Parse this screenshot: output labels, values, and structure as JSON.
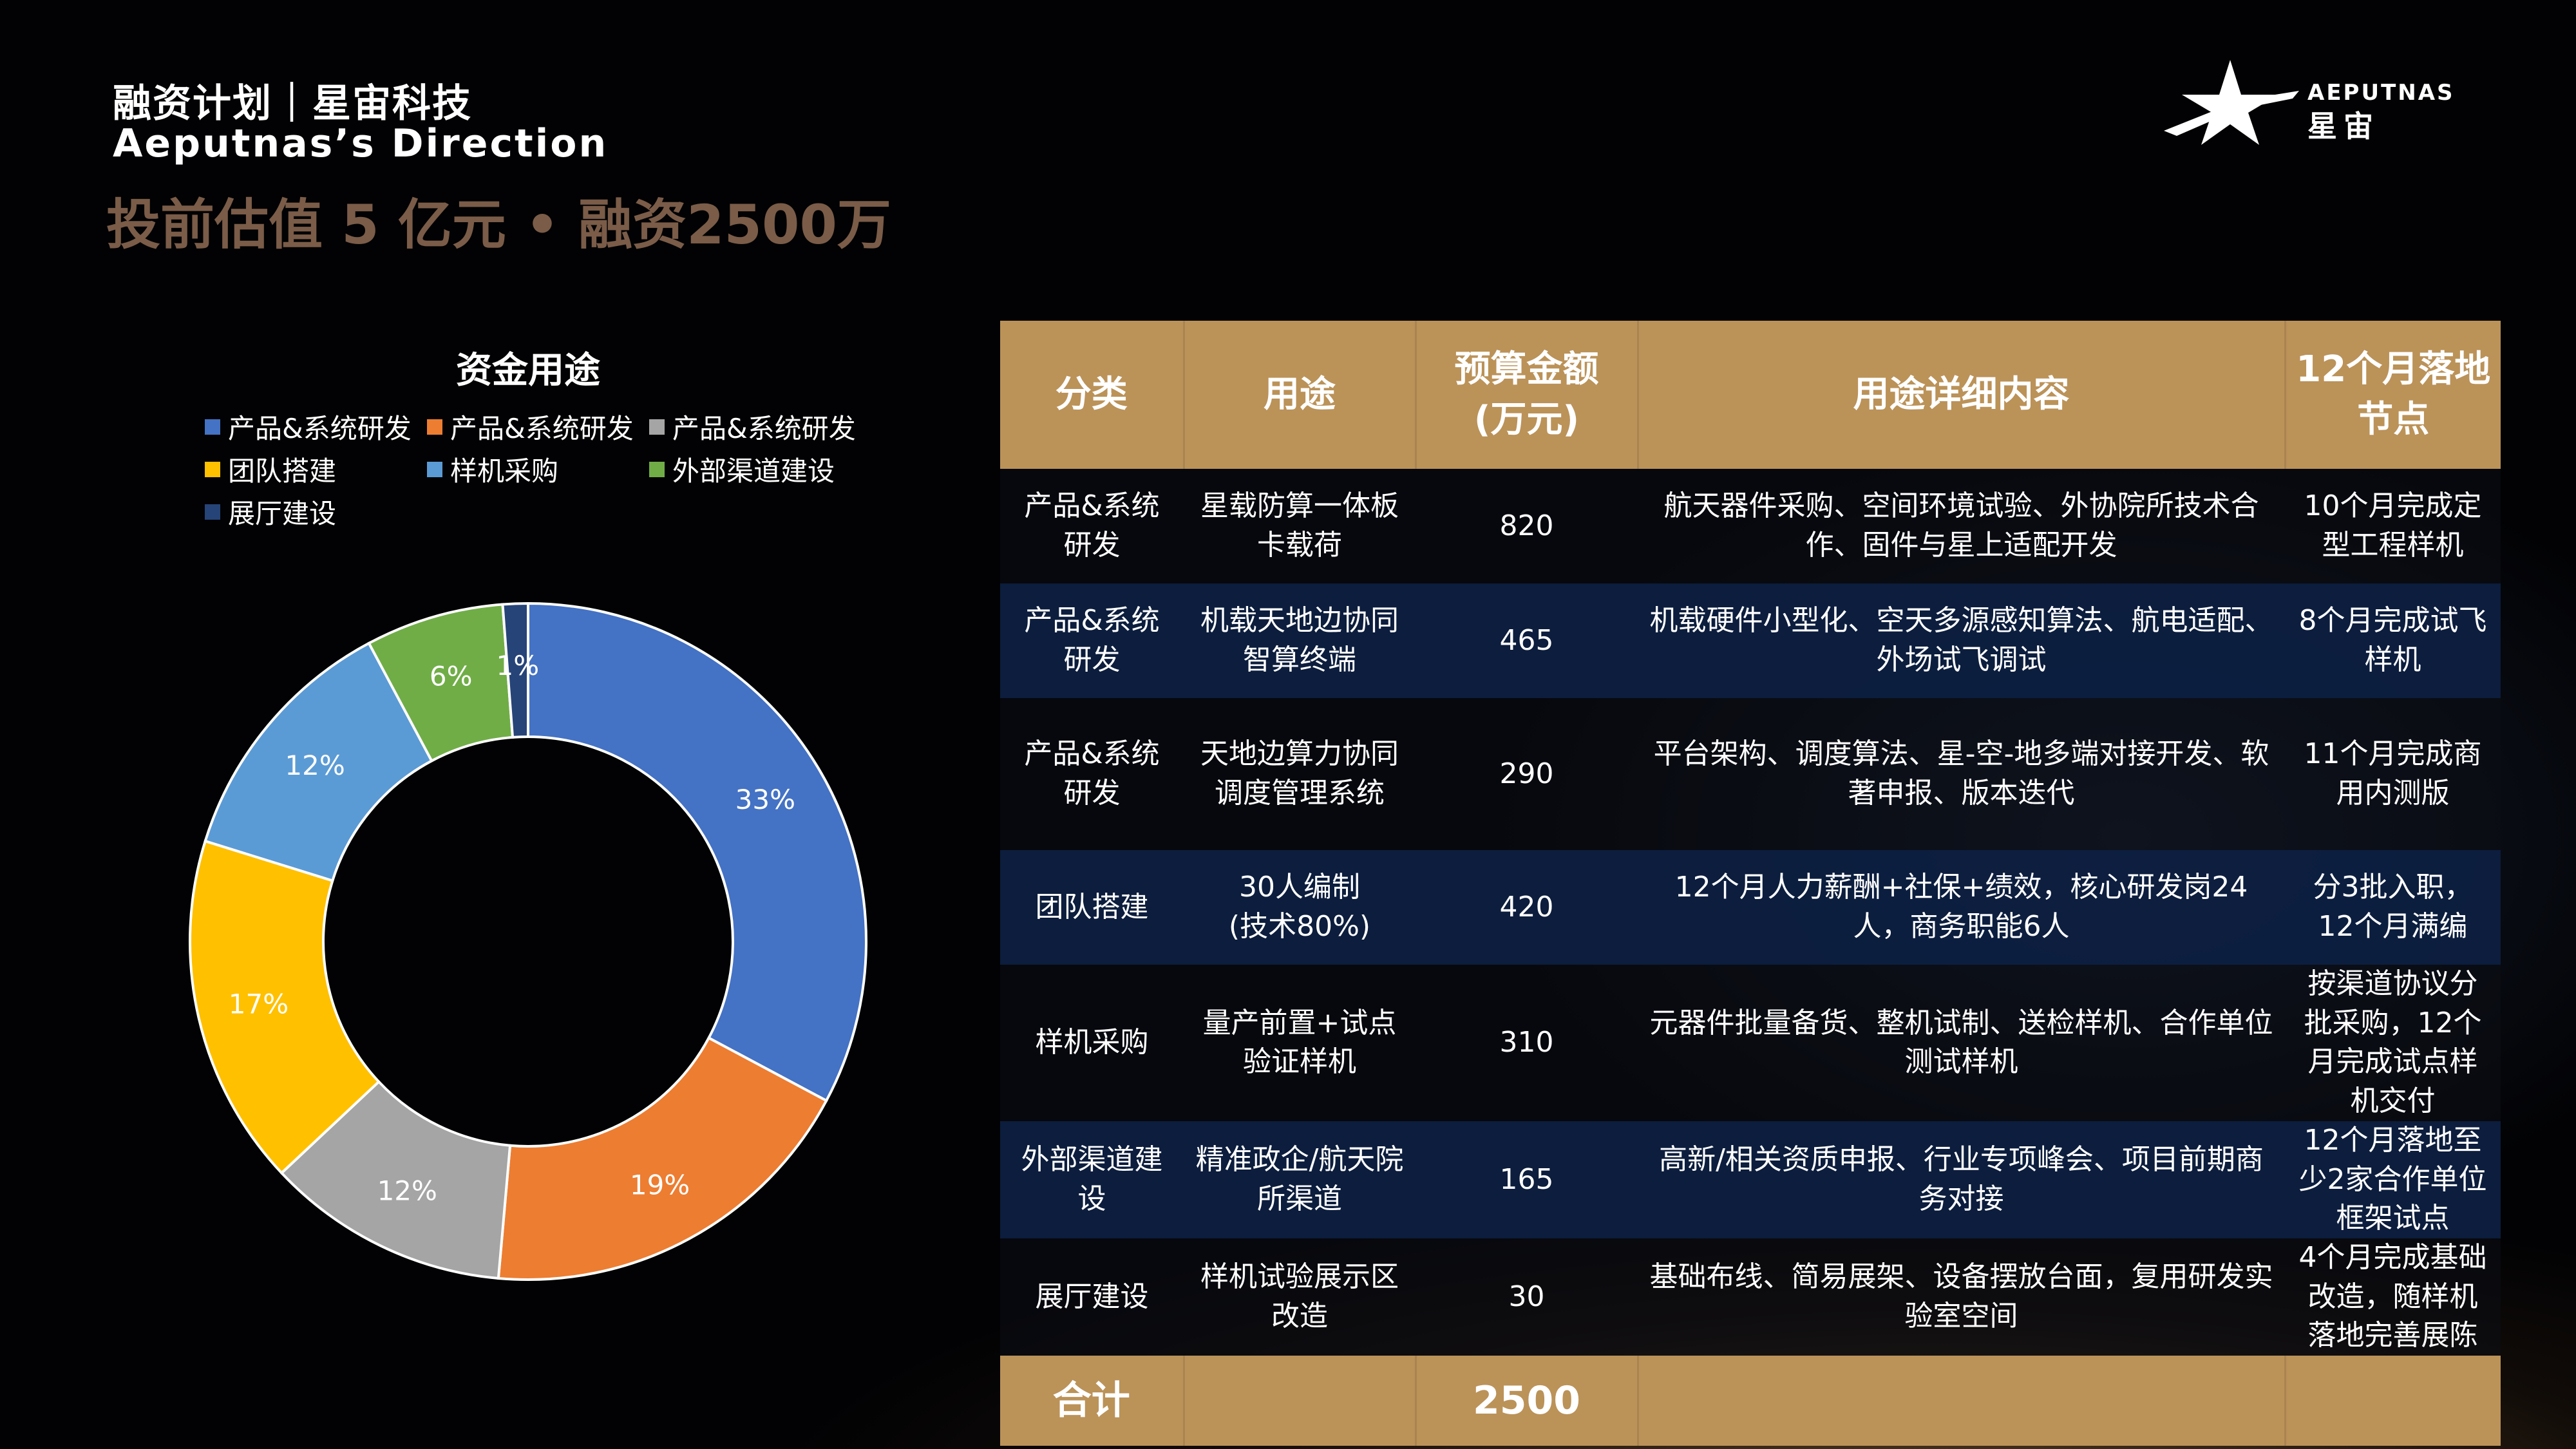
{
  "header": {
    "title_line1": "融资计划｜星宙科技",
    "title_line2": "Aeputnas’s Direction",
    "headline": "投前估值 5 亿元 • 融资2500万"
  },
  "logo": {
    "brand_en": "AEPUTNAS",
    "brand_cn": "星宙",
    "icon": "star-icon"
  },
  "chart_data": {
    "type": "pie",
    "variant": "donut",
    "title": "资金用途",
    "legend_position": "top",
    "categories": [
      "产品&系统研发",
      "产品&系统研发",
      "产品&系统研发",
      "团队搭建",
      "样机采购",
      "外部渠道建设",
      "展厅建设"
    ],
    "values": [
      820,
      465,
      290,
      420,
      310,
      165,
      30
    ],
    "data_labels": [
      "33%",
      "19%",
      "12%",
      "17%",
      "12%",
      "6%",
      "1%"
    ],
    "colors": [
      "#4472c4",
      "#ed7d31",
      "#a5a5a5",
      "#ffc000",
      "#5b9bd5",
      "#70ad47",
      "#264478"
    ]
  },
  "table": {
    "headers": [
      "分类",
      "用途",
      "预算金额\n(万元)",
      "用途详细内容",
      "12个月落地节点"
    ],
    "rows": [
      {
        "category": "产品&系统研发",
        "use": "星载防算一体板卡载荷",
        "amount": "820",
        "detail": "航天器件采购、空间环境试验、外协院所技术合作、固件与星上适配开发",
        "milestone": "10个月完成定型工程样机"
      },
      {
        "category": "产品&系统研发",
        "use": "机载天地边协同智算终端",
        "amount": "465",
        "detail": "机载硬件小型化、空天多源感知算法、航电适配、外场试飞调试",
        "milestone": "8个月完成试飞样机"
      },
      {
        "category": "产品&系统研发",
        "use": "天地边算力协同调度管理系统",
        "amount": "290",
        "detail": "平台架构、调度算法、星-空-地多端对接开发、软著申报、版本迭代",
        "milestone": "11个月完成商用内测版"
      },
      {
        "category": "团队搭建",
        "use": "30人编制\n(技术80%)",
        "amount": "420",
        "detail": "12个月人力薪酬+社保+绩效，核心研发岗24人，商务职能6人",
        "milestone": "分3批入职，12个月满编"
      },
      {
        "category": "样机采购",
        "use": "量产前置+试点验证样机",
        "amount": "310",
        "detail": "元器件批量备货、整机试制、送检样机、合作单位测试样机",
        "milestone": "按渠道协议分批采购，12个月完成试点样机交付"
      },
      {
        "category": "外部渠道建设",
        "use": "精准政企/航天院所渠道",
        "amount": "165",
        "detail": "高新/相关资质申报、行业专项峰会、项目前期商务对接",
        "milestone": "12个月落地至少2家合作单位框架试点"
      },
      {
        "category": "展厅建设",
        "use": "样机试验展示区改造",
        "amount": "30",
        "detail": "基础布线、简易展架、设备摆放台面，复用研发实验室空间",
        "milestone": "4个月完成基础改造，随样机落地完善展陈"
      }
    ],
    "total": {
      "label": "合计",
      "amount": "2500"
    }
  }
}
